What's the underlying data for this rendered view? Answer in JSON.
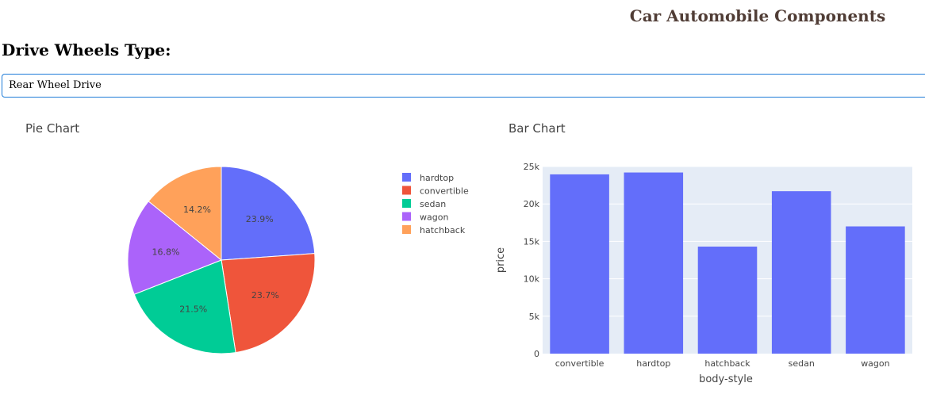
{
  "header": {
    "title": "Car Automobile Components"
  },
  "controls": {
    "label": "Drive Wheels Type:",
    "dropdown_value": "Rear Wheel Drive"
  },
  "chart_data": [
    {
      "type": "pie",
      "title": "Pie Chart",
      "labels": [
        "hardtop",
        "convertible",
        "sedan",
        "wagon",
        "hatchback"
      ],
      "values": [
        23.9,
        23.7,
        21.5,
        16.8,
        14.2
      ],
      "value_labels": [
        "23.9%",
        "23.7%",
        "21.5%",
        "16.8%",
        "14.2%"
      ],
      "colors": [
        "#636efa",
        "#ef553b",
        "#00cc96",
        "#ab63fa",
        "#ffa15a"
      ],
      "legend": "right"
    },
    {
      "type": "bar",
      "title": "Bar Chart",
      "categories": [
        "convertible",
        "hardtop",
        "hatchback",
        "sedan",
        "wagon"
      ],
      "values": [
        23950,
        24200,
        14300,
        21700,
        17000
      ],
      "xlabel": "body-style",
      "ylabel": "price",
      "ylim": [
        0,
        25000
      ],
      "yticks": [
        0,
        5000,
        10000,
        15000,
        20000,
        25000
      ],
      "ytick_labels": [
        "0",
        "5k",
        "10k",
        "15k",
        "20k",
        "25k"
      ],
      "color": "#636efa",
      "plot_bgcolor": "#e5ecf6",
      "grid": true
    }
  ]
}
